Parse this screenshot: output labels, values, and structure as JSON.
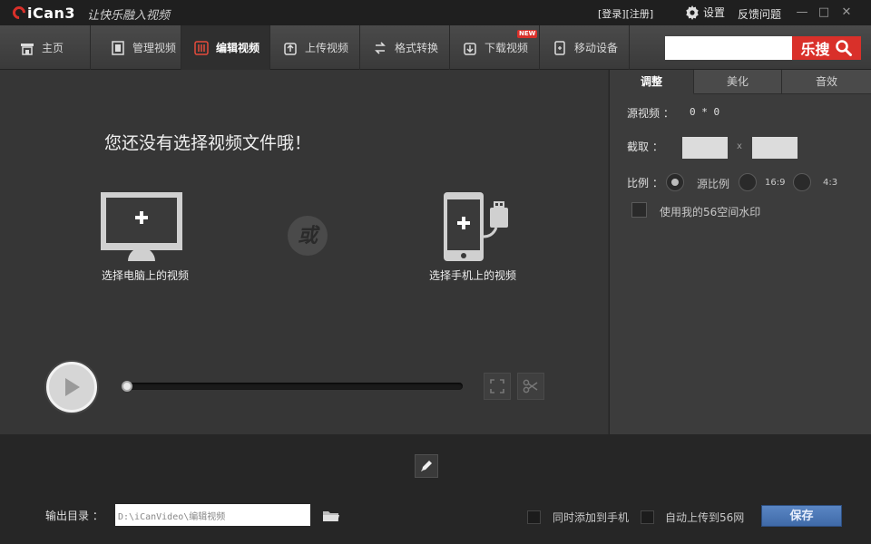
{
  "titlebar": {
    "brand": "iCan3",
    "slogan": "让快乐融入视频",
    "login": "[登录][注册]",
    "settings_label": "设置",
    "feedback_label": "反馈问题",
    "icons": {
      "settings": "gear-icon",
      "minimize": "minimize-icon",
      "maximize": "maximize-icon",
      "close": "close-icon"
    }
  },
  "nav": {
    "items": [
      {
        "label": "主页",
        "icon": "home-icon"
      },
      {
        "label": "管理视频",
        "icon": "film-icon"
      },
      {
        "label": "编辑视频",
        "icon": "edit-sliders-icon",
        "active": true
      },
      {
        "label": "上传视频",
        "icon": "upload-icon"
      },
      {
        "label": "格式转换",
        "icon": "convert-icon"
      },
      {
        "label": "下载视频",
        "icon": "download-icon"
      },
      {
        "label": "移动设备",
        "icon": "mobile-device-icon"
      }
    ],
    "new_badge": "NEW",
    "search_button_label": "乐搜",
    "search_value": ""
  },
  "main": {
    "empty_message": "您还没有选择视频文件哦！",
    "pc_label": "选择电脑上的视频",
    "or_label": "或",
    "phone_label": "选择手机上的视频",
    "progress": 0
  },
  "panel": {
    "tabs": [
      {
        "label": "调整",
        "active": true
      },
      {
        "label": "美化"
      },
      {
        "label": "音效"
      }
    ],
    "source_label": "源视频 ：",
    "source_value": "0 * 0",
    "crop_label": "截取 ：",
    "crop_sep": "x",
    "ratio_label": "比例 ：",
    "ratio_options": [
      {
        "label": "源比例",
        "selected": true
      },
      {
        "label": "16:9",
        "selected": false
      },
      {
        "label": "4:3",
        "selected": false
      }
    ],
    "watermark_label": "使用我的56空间水印",
    "watermark_checked": false
  },
  "bottom": {
    "output_label": "输出目录 ：",
    "output_path": "D:\\iCanVideo\\编辑视频",
    "sync_phone_label": "同时添加到手机",
    "auto_upload_label": "自动上传到56网",
    "save_label": "保存"
  },
  "colors": {
    "accent_red": "#d9302a",
    "save_blue": "#4a78b8",
    "background": "#2f2f2f"
  }
}
